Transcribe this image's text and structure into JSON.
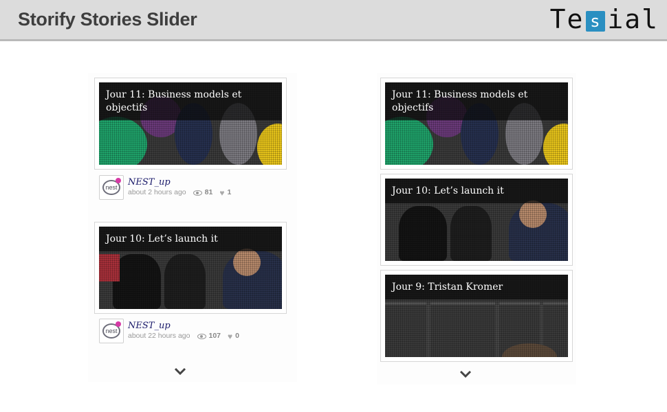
{
  "header": {
    "title": "Storify Stories Slider",
    "logo_left": "Te",
    "logo_mid": "s",
    "logo_right": "ial"
  },
  "column_left": {
    "stories": [
      {
        "title": "Jour 11: Business models et objectifs",
        "user": "NEST_up",
        "time": "about 2 hours ago",
        "views": "81",
        "likes": "1",
        "avatar_text": "nest"
      },
      {
        "title": "Jour 10: Let’s launch it",
        "user": "NEST_up",
        "time": "about 22 hours ago",
        "views": "107",
        "likes": "0",
        "avatar_text": "nest"
      }
    ]
  },
  "column_right": {
    "stories": [
      {
        "title": "Jour 11: Business models et objectifs"
      },
      {
        "title": "Jour 10: Let’s launch it"
      },
      {
        "title": "Jour 9: Tristan Kromer"
      }
    ]
  },
  "colors": {
    "header_bg": "#dcdcdc",
    "logo_accent": "#2a8fc1",
    "username": "#1a1a6a",
    "avatar_dot": "#d63aa5"
  },
  "icons": [
    "eye-icon",
    "heart-icon",
    "chevron-down-icon"
  ]
}
